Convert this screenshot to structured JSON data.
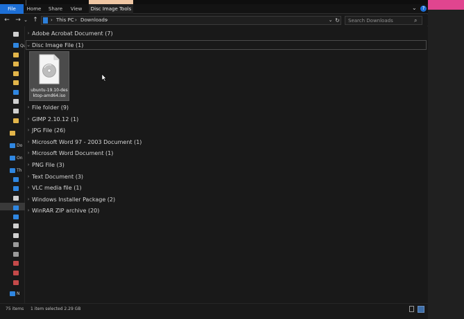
{
  "ribbon": {
    "tabs": [
      "File",
      "Home",
      "Share",
      "View",
      "Disc Image Tools"
    ],
    "collapse_glyph": "⌄",
    "help_glyph": "?"
  },
  "nav": {
    "back": "←",
    "forward": "→",
    "recent": "⌄",
    "up": "↑",
    "breadcrumb": [
      "This PC",
      "Downloads"
    ],
    "separator": "›",
    "dropdown": "⌄",
    "refresh": "↻"
  },
  "search": {
    "placeholder": "Search Downloads",
    "icon": "search-icon"
  },
  "navpane": {
    "labels": [
      "Qu",
      "Do",
      "On",
      "Th",
      "N"
    ]
  },
  "groups": [
    "Adobe Acrobat Document (7)",
    "Disc Image File (1)",
    "File folder (9)",
    "GIMP 2.10.12 (1)",
    "JPG File (26)",
    "Microsoft Word 97 - 2003 Document (1)",
    "Microsoft Word Document (1)",
    "PNG File (3)",
    "Text Document (3)",
    "VLC media file (1)",
    "Windows Installer Package (2)",
    "WinRAR ZIP archive (20)"
  ],
  "file": {
    "name": "ubuntu-19.10-desktop-amd64.iso",
    "icon": "disc-image-icon"
  },
  "status": {
    "count": "75 items",
    "selected": "1 item selected  2.29 GB"
  },
  "colors": {
    "accent": "#1d6fd6",
    "manage_tab": "#f0c7a4",
    "desktop_pink": "#e0458f"
  }
}
